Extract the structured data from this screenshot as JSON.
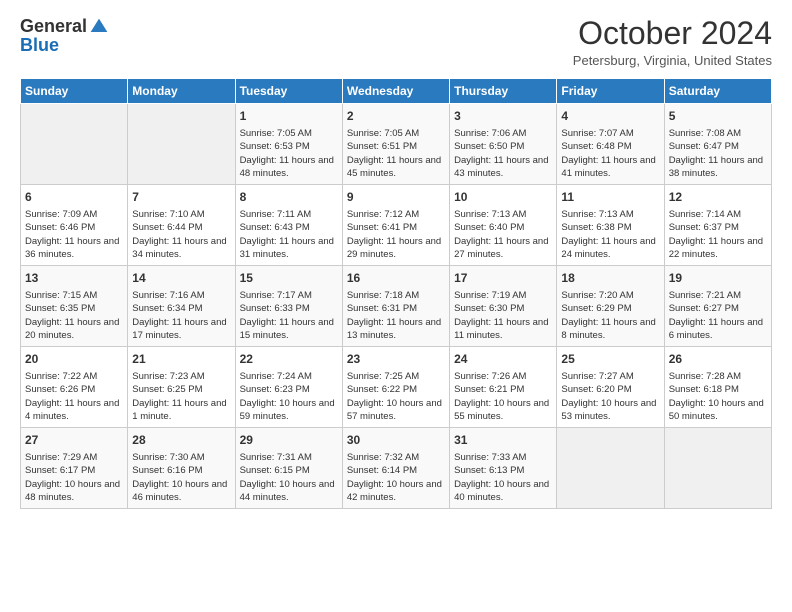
{
  "header": {
    "logo_general": "General",
    "logo_blue": "Blue",
    "month_title": "October 2024",
    "location": "Petersburg, Virginia, United States"
  },
  "days_of_week": [
    "Sunday",
    "Monday",
    "Tuesday",
    "Wednesday",
    "Thursday",
    "Friday",
    "Saturday"
  ],
  "weeks": [
    [
      {
        "day": "",
        "empty": true
      },
      {
        "day": "",
        "empty": true
      },
      {
        "day": "1",
        "sunrise": "Sunrise: 7:05 AM",
        "sunset": "Sunset: 6:53 PM",
        "daylight": "Daylight: 11 hours and 48 minutes."
      },
      {
        "day": "2",
        "sunrise": "Sunrise: 7:05 AM",
        "sunset": "Sunset: 6:51 PM",
        "daylight": "Daylight: 11 hours and 45 minutes."
      },
      {
        "day": "3",
        "sunrise": "Sunrise: 7:06 AM",
        "sunset": "Sunset: 6:50 PM",
        "daylight": "Daylight: 11 hours and 43 minutes."
      },
      {
        "day": "4",
        "sunrise": "Sunrise: 7:07 AM",
        "sunset": "Sunset: 6:48 PM",
        "daylight": "Daylight: 11 hours and 41 minutes."
      },
      {
        "day": "5",
        "sunrise": "Sunrise: 7:08 AM",
        "sunset": "Sunset: 6:47 PM",
        "daylight": "Daylight: 11 hours and 38 minutes."
      }
    ],
    [
      {
        "day": "6",
        "sunrise": "Sunrise: 7:09 AM",
        "sunset": "Sunset: 6:46 PM",
        "daylight": "Daylight: 11 hours and 36 minutes."
      },
      {
        "day": "7",
        "sunrise": "Sunrise: 7:10 AM",
        "sunset": "Sunset: 6:44 PM",
        "daylight": "Daylight: 11 hours and 34 minutes."
      },
      {
        "day": "8",
        "sunrise": "Sunrise: 7:11 AM",
        "sunset": "Sunset: 6:43 PM",
        "daylight": "Daylight: 11 hours and 31 minutes."
      },
      {
        "day": "9",
        "sunrise": "Sunrise: 7:12 AM",
        "sunset": "Sunset: 6:41 PM",
        "daylight": "Daylight: 11 hours and 29 minutes."
      },
      {
        "day": "10",
        "sunrise": "Sunrise: 7:13 AM",
        "sunset": "Sunset: 6:40 PM",
        "daylight": "Daylight: 11 hours and 27 minutes."
      },
      {
        "day": "11",
        "sunrise": "Sunrise: 7:13 AM",
        "sunset": "Sunset: 6:38 PM",
        "daylight": "Daylight: 11 hours and 24 minutes."
      },
      {
        "day": "12",
        "sunrise": "Sunrise: 7:14 AM",
        "sunset": "Sunset: 6:37 PM",
        "daylight": "Daylight: 11 hours and 22 minutes."
      }
    ],
    [
      {
        "day": "13",
        "sunrise": "Sunrise: 7:15 AM",
        "sunset": "Sunset: 6:35 PM",
        "daylight": "Daylight: 11 hours and 20 minutes."
      },
      {
        "day": "14",
        "sunrise": "Sunrise: 7:16 AM",
        "sunset": "Sunset: 6:34 PM",
        "daylight": "Daylight: 11 hours and 17 minutes."
      },
      {
        "day": "15",
        "sunrise": "Sunrise: 7:17 AM",
        "sunset": "Sunset: 6:33 PM",
        "daylight": "Daylight: 11 hours and 15 minutes."
      },
      {
        "day": "16",
        "sunrise": "Sunrise: 7:18 AM",
        "sunset": "Sunset: 6:31 PM",
        "daylight": "Daylight: 11 hours and 13 minutes."
      },
      {
        "day": "17",
        "sunrise": "Sunrise: 7:19 AM",
        "sunset": "Sunset: 6:30 PM",
        "daylight": "Daylight: 11 hours and 11 minutes."
      },
      {
        "day": "18",
        "sunrise": "Sunrise: 7:20 AM",
        "sunset": "Sunset: 6:29 PM",
        "daylight": "Daylight: 11 hours and 8 minutes."
      },
      {
        "day": "19",
        "sunrise": "Sunrise: 7:21 AM",
        "sunset": "Sunset: 6:27 PM",
        "daylight": "Daylight: 11 hours and 6 minutes."
      }
    ],
    [
      {
        "day": "20",
        "sunrise": "Sunrise: 7:22 AM",
        "sunset": "Sunset: 6:26 PM",
        "daylight": "Daylight: 11 hours and 4 minutes."
      },
      {
        "day": "21",
        "sunrise": "Sunrise: 7:23 AM",
        "sunset": "Sunset: 6:25 PM",
        "daylight": "Daylight: 11 hours and 1 minute."
      },
      {
        "day": "22",
        "sunrise": "Sunrise: 7:24 AM",
        "sunset": "Sunset: 6:23 PM",
        "daylight": "Daylight: 10 hours and 59 minutes."
      },
      {
        "day": "23",
        "sunrise": "Sunrise: 7:25 AM",
        "sunset": "Sunset: 6:22 PM",
        "daylight": "Daylight: 10 hours and 57 minutes."
      },
      {
        "day": "24",
        "sunrise": "Sunrise: 7:26 AM",
        "sunset": "Sunset: 6:21 PM",
        "daylight": "Daylight: 10 hours and 55 minutes."
      },
      {
        "day": "25",
        "sunrise": "Sunrise: 7:27 AM",
        "sunset": "Sunset: 6:20 PM",
        "daylight": "Daylight: 10 hours and 53 minutes."
      },
      {
        "day": "26",
        "sunrise": "Sunrise: 7:28 AM",
        "sunset": "Sunset: 6:18 PM",
        "daylight": "Daylight: 10 hours and 50 minutes."
      }
    ],
    [
      {
        "day": "27",
        "sunrise": "Sunrise: 7:29 AM",
        "sunset": "Sunset: 6:17 PM",
        "daylight": "Daylight: 10 hours and 48 minutes."
      },
      {
        "day": "28",
        "sunrise": "Sunrise: 7:30 AM",
        "sunset": "Sunset: 6:16 PM",
        "daylight": "Daylight: 10 hours and 46 minutes."
      },
      {
        "day": "29",
        "sunrise": "Sunrise: 7:31 AM",
        "sunset": "Sunset: 6:15 PM",
        "daylight": "Daylight: 10 hours and 44 minutes."
      },
      {
        "day": "30",
        "sunrise": "Sunrise: 7:32 AM",
        "sunset": "Sunset: 6:14 PM",
        "daylight": "Daylight: 10 hours and 42 minutes."
      },
      {
        "day": "31",
        "sunrise": "Sunrise: 7:33 AM",
        "sunset": "Sunset: 6:13 PM",
        "daylight": "Daylight: 10 hours and 40 minutes."
      },
      {
        "day": "",
        "empty": true
      },
      {
        "day": "",
        "empty": true
      }
    ]
  ]
}
